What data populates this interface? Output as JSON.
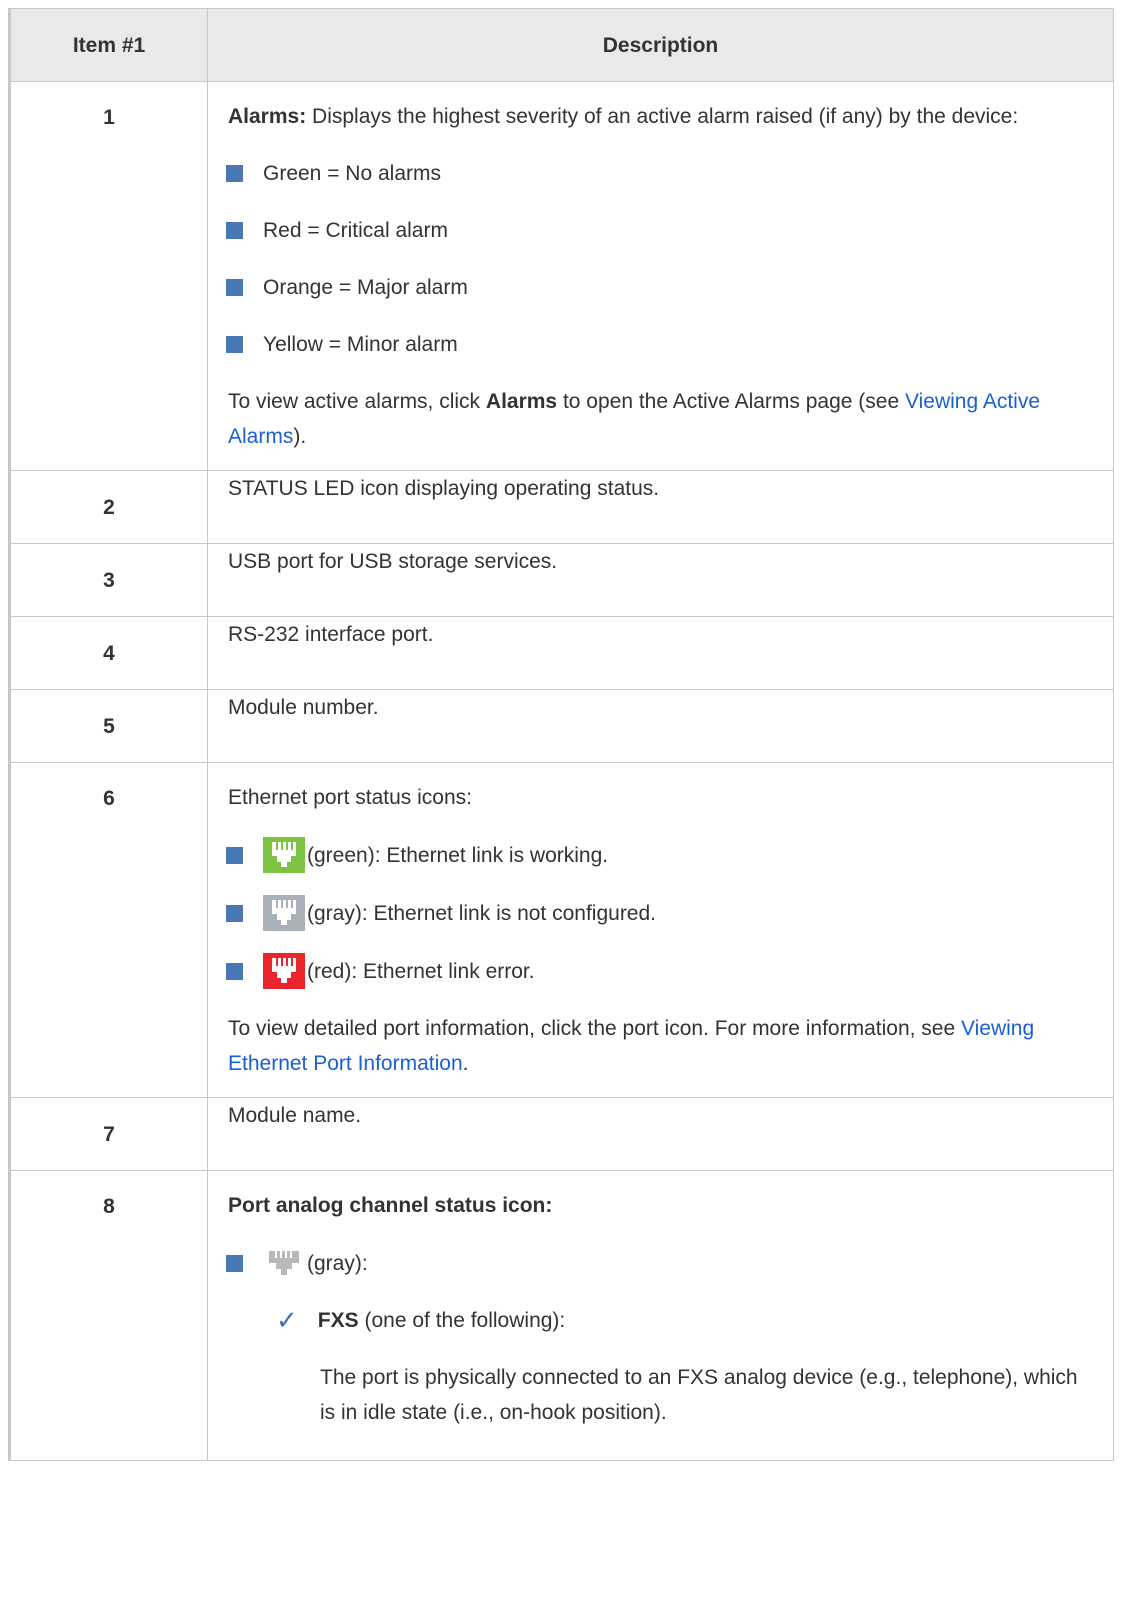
{
  "header": {
    "col1": "Item #1",
    "col2": "Description"
  },
  "rows": {
    "r1": {
      "num": "1",
      "lead_bold": "Alarms:",
      "lead_text": " Displays the highest severity of an active alarm raised (if any) by the device:",
      "bullets": [
        "Green = No alarms",
        "Red = Critical alarm",
        "Orange = Major alarm",
        "Yellow = Minor alarm"
      ],
      "after_pre": "To view active alarms, click ",
      "after_bold": "Alarms",
      "after_mid": " to open the Active Alarms page (see ",
      "after_link": "Viewing Active Alarms",
      "after_post": ")."
    },
    "r2": {
      "num": "2",
      "text": "STATUS LED icon displaying operating status."
    },
    "r3": {
      "num": "3",
      "text": "USB port for USB storage services."
    },
    "r4": {
      "num": "4",
      "text": "RS-232 interface port."
    },
    "r5": {
      "num": "5",
      "text": "Module number."
    },
    "r6": {
      "num": "6",
      "lead": "Ethernet port status icons:",
      "bullets": [
        "(green): Ethernet link is working.",
        "(gray): Ethernet link is not configured.",
        "(red): Ethernet link error."
      ],
      "after_pre": "To view detailed port information, click the port icon. For more information, see ",
      "after_link": "Viewing Ethernet Port Information",
      "after_post": "."
    },
    "r7": {
      "num": "7",
      "text": "Module name."
    },
    "r8": {
      "num": "8",
      "lead_bold": "Port analog channel status icon:",
      "bullet": "(gray):",
      "check_bold": "FXS",
      "check_text": " (one of the following):",
      "sub_text": "The port is physically connected to an FXS analog device (e.g., telephone), which is in idle state (i.e., on-hook position)."
    }
  },
  "icons": {
    "bullet_color": "#4a78b5",
    "eth_green": "#7dc242",
    "eth_gray": "#a9b0b8",
    "eth_red": "#e8262b",
    "analog_gray": "#b9b9b9",
    "link_color": "#1a5fd6"
  }
}
